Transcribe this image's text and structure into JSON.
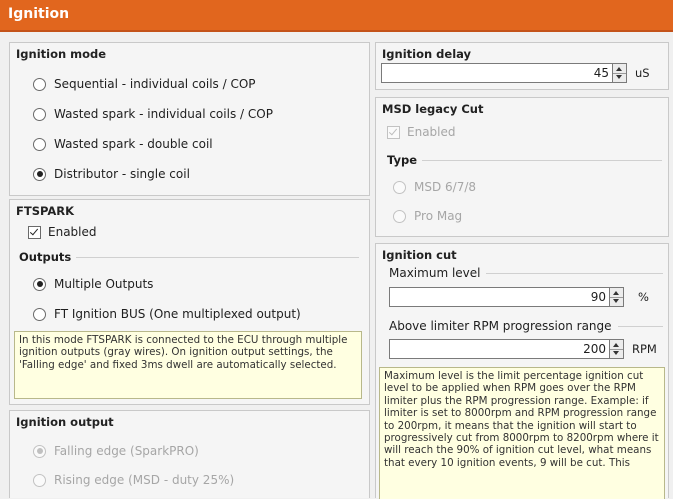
{
  "window": {
    "title": "Ignition"
  },
  "ignition_mode": {
    "title": "Ignition mode",
    "options": [
      {
        "label": "Sequential - individual coils / COP",
        "selected": false
      },
      {
        "label": "Wasted spark - individual coils / COP",
        "selected": false
      },
      {
        "label": "Wasted spark - double coil",
        "selected": false
      },
      {
        "label": "Distributor - single coil",
        "selected": true
      }
    ]
  },
  "ftspark": {
    "title": "FTSPARK",
    "enabled_label": "Enabled",
    "enabled": true,
    "outputs_title": "Outputs",
    "options": [
      {
        "label": "Multiple Outputs",
        "selected": true
      },
      {
        "label": "FT Ignition BUS (One multiplexed output)",
        "selected": false
      }
    ],
    "info": "In this mode FTSPARK is connected to the ECU through multiple ignition outputs (gray wires). On ignition output settings, the 'Falling edge' and fixed 3ms dwell are automatically selected."
  },
  "ignition_output": {
    "title": "Ignition output",
    "options": [
      {
        "label": "Falling edge (SparkPRO)",
        "selected": true
      },
      {
        "label": "Rising edge (MSD - duty 25%)",
        "selected": false
      }
    ]
  },
  "ignition_delay": {
    "title": "Ignition delay",
    "value": "45",
    "unit": "uS"
  },
  "msd_legacy_cut": {
    "title": "MSD legacy Cut",
    "enabled_label": "Enabled",
    "enabled": true,
    "type_title": "Type",
    "options": [
      {
        "label": "MSD 6/7/8",
        "selected": false
      },
      {
        "label": "Pro Mag",
        "selected": false
      }
    ]
  },
  "ignition_cut": {
    "title": "Ignition cut",
    "max_level_label": "Maximum level",
    "max_level_value": "90",
    "max_level_unit": "%",
    "rpm_range_label": "Above limiter RPM progression range",
    "rpm_range_value": "200",
    "rpm_range_unit": "RPM",
    "info": "Maximum level is the limit percentage ignition cut level to be applied when RPM goes over the RPM limiter plus the RPM progression range. Example: if limiter is set to 8000rpm and RPM progression range to 200rpm, it means that the ignition will start to progressively cut from 8000rpm to 8200rpm where it will reach the 90% of ignition cut level, what means that every 10 ignition events, 9 will be cut. This"
  }
}
